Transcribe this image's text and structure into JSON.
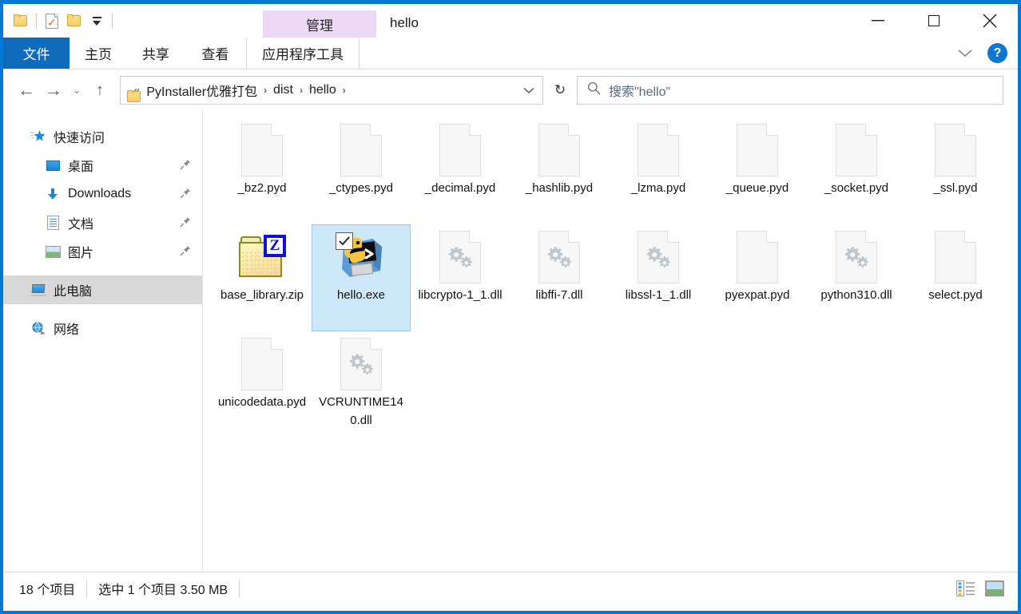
{
  "window": {
    "title": "hello",
    "contextual_header": "管理",
    "accent_color": "#0078d7",
    "contextual_color": "#edd8f5"
  },
  "quick_access_toolbar": {
    "items": [
      {
        "name": "folder-icon",
        "label": ""
      },
      {
        "name": "properties-icon",
        "label": ""
      },
      {
        "name": "new-folder-icon",
        "label": ""
      },
      {
        "name": "customize-caret-icon",
        "label": ""
      }
    ]
  },
  "window_controls": {
    "minimize": "—",
    "maximize": "",
    "close": "✕",
    "collapse_ribbon": "",
    "help": "?"
  },
  "tabs": [
    {
      "label": "文件",
      "selected": true
    },
    {
      "label": "主页",
      "selected": false
    },
    {
      "label": "共享",
      "selected": false
    },
    {
      "label": "查看",
      "selected": false
    },
    {
      "label": "应用程序工具",
      "selected": false,
      "contextual": true
    }
  ],
  "navigation": {
    "back": "←",
    "forward": "→",
    "recent": "⌄",
    "up": "↑",
    "refresh": "↻",
    "dropdown": "⌄"
  },
  "address": {
    "ellipsis": "«",
    "crumbs": [
      "PyInstaller优雅打包",
      "dist",
      "hello"
    ],
    "separator": "›"
  },
  "search": {
    "placeholder": "搜索\"hello\"",
    "icon": "search-icon"
  },
  "sidebar": {
    "items": [
      {
        "label": "快速访问",
        "icon": "star-icon",
        "level": 1,
        "pinned": false,
        "selected": false
      },
      {
        "label": "桌面",
        "icon": "desktop-icon",
        "level": 2,
        "pinned": true,
        "selected": false
      },
      {
        "label": "Downloads",
        "icon": "download-icon",
        "level": 2,
        "pinned": true,
        "selected": false
      },
      {
        "label": "文档",
        "icon": "documents-icon",
        "level": 2,
        "pinned": true,
        "selected": false
      },
      {
        "label": "图片",
        "icon": "pictures-icon",
        "level": 2,
        "pinned": true,
        "selected": false
      },
      {
        "label": "此电脑",
        "icon": "this-pc-icon",
        "level": 1,
        "pinned": false,
        "selected": true
      },
      {
        "label": "网络",
        "icon": "network-icon",
        "level": 1,
        "pinned": false,
        "selected": false
      }
    ],
    "pin_glyph": "📌"
  },
  "files": [
    {
      "name": "_bz2.pyd",
      "icon": "blank-file-icon",
      "selected": false,
      "checked": false
    },
    {
      "name": "_ctypes.pyd",
      "icon": "blank-file-icon",
      "selected": false,
      "checked": false
    },
    {
      "name": "_decimal.pyd",
      "icon": "blank-file-icon",
      "selected": false,
      "checked": false
    },
    {
      "name": "_hashlib.pyd",
      "icon": "blank-file-icon",
      "selected": false,
      "checked": false
    },
    {
      "name": "_lzma.pyd",
      "icon": "blank-file-icon",
      "selected": false,
      "checked": false
    },
    {
      "name": "_queue.pyd",
      "icon": "blank-file-icon",
      "selected": false,
      "checked": false
    },
    {
      "name": "_socket.pyd",
      "icon": "blank-file-icon",
      "selected": false,
      "checked": false
    },
    {
      "name": "_ssl.pyd",
      "icon": "blank-file-icon",
      "selected": false,
      "checked": false
    },
    {
      "name": "base_library.zip",
      "icon": "zip-folder-icon",
      "selected": false,
      "checked": false
    },
    {
      "name": "hello.exe",
      "icon": "python-exe-icon",
      "selected": true,
      "checked": true
    },
    {
      "name": "libcrypto-1_1.dll",
      "icon": "dll-gears-icon",
      "selected": false,
      "checked": false
    },
    {
      "name": "libffi-7.dll",
      "icon": "dll-gears-icon",
      "selected": false,
      "checked": false
    },
    {
      "name": "libssl-1_1.dll",
      "icon": "dll-gears-icon",
      "selected": false,
      "checked": false
    },
    {
      "name": "pyexpat.pyd",
      "icon": "blank-file-icon",
      "selected": false,
      "checked": false
    },
    {
      "name": "python310.dll",
      "icon": "dll-gears-icon",
      "selected": false,
      "checked": false
    },
    {
      "name": "select.pyd",
      "icon": "blank-file-icon",
      "selected": false,
      "checked": false
    },
    {
      "name": "unicodedata.pyd",
      "icon": "blank-file-icon",
      "selected": false,
      "checked": false
    },
    {
      "name": "VCRUNTIME140.dll",
      "icon": "dll-gears-icon",
      "selected": false,
      "checked": false
    }
  ],
  "status_bar": {
    "item_count": "18 个项目",
    "selection": "选中 1 个项目  3.50 MB",
    "views": [
      {
        "name": "details-view-button"
      },
      {
        "name": "large-icons-view-button"
      }
    ]
  }
}
